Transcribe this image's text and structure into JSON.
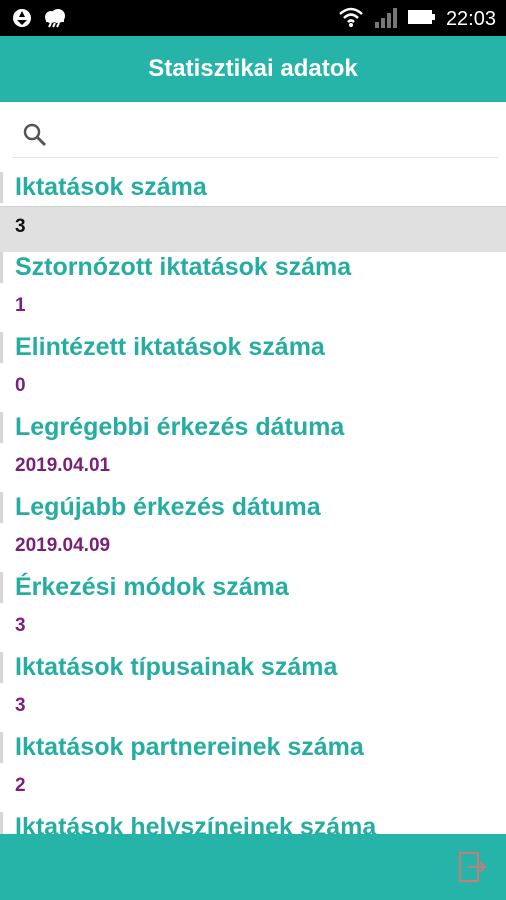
{
  "status_bar": {
    "time": "22:03",
    "icons": [
      "aperture-icon",
      "cloud-icon",
      "wifi-icon",
      "signal-icon",
      "battery-icon"
    ]
  },
  "app_bar": {
    "title": "Statisztikai adatok"
  },
  "search": {
    "placeholder": "",
    "icon": "search-icon"
  },
  "stats": [
    {
      "label": "Iktatások száma",
      "value": "3",
      "selected": true
    },
    {
      "label": "Sztornózott iktatások száma",
      "value": "1"
    },
    {
      "label": "Elintézett iktatások száma",
      "value": "0"
    },
    {
      "label": "Legrégebbi érkezés dátuma",
      "value": "2019.04.01"
    },
    {
      "label": "Legújabb érkezés dátuma",
      "value": "2019.04.09"
    },
    {
      "label": "Érkezési módok száma",
      "value": "3"
    },
    {
      "label": "Iktatások típusainak száma",
      "value": "3"
    },
    {
      "label": "Iktatások partnereinek száma",
      "value": "2"
    },
    {
      "label": "Iktatások helyszíneinek száma",
      "value": ""
    }
  ],
  "bottom_bar": {
    "logout_icon": "logout-icon"
  },
  "colors": {
    "primary": "#26b3a8",
    "label": "#26ada2",
    "value": "#7b1f7b",
    "selected_bg": "#e0e0e0",
    "logout_icon": "#c97a7a"
  }
}
